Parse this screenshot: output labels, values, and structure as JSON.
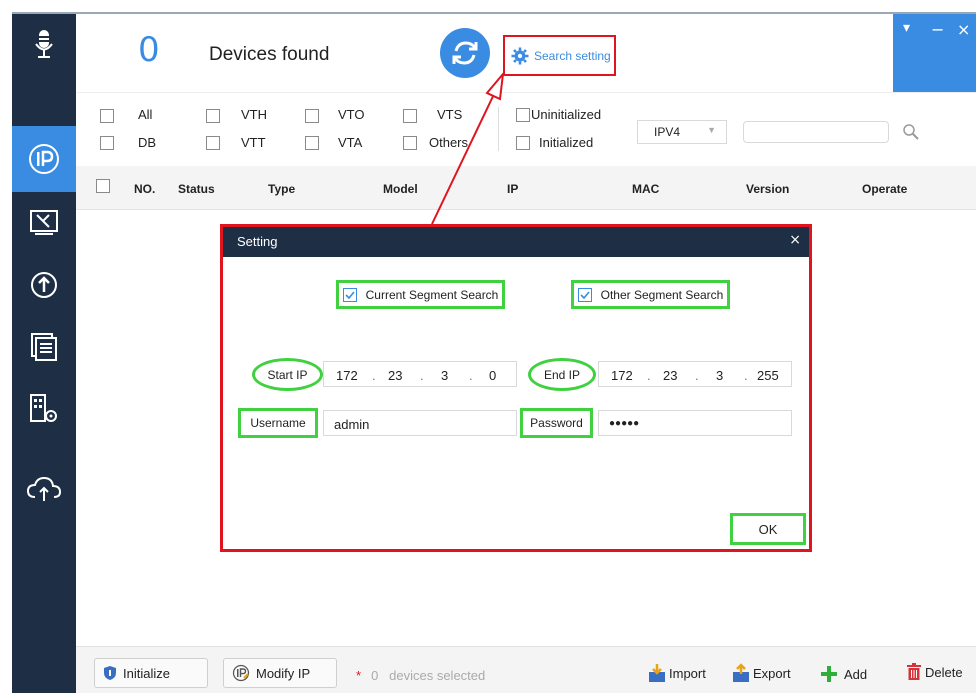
{
  "header": {
    "count": "0",
    "devices_found": "Devices found",
    "search_setting_label": "Search setting",
    "window_controls": {
      "menu": "▾",
      "minimize": "−",
      "close": "×"
    }
  },
  "filters": {
    "row1": [
      {
        "label": "All"
      },
      {
        "label": "VTH"
      },
      {
        "label": "VTO"
      },
      {
        "label": "VTS"
      }
    ],
    "row2": [
      {
        "label": "DB"
      },
      {
        "label": "VTT"
      },
      {
        "label": "VTA"
      },
      {
        "label": "Others"
      }
    ],
    "uninitialized": "Uninitialized",
    "initialized": "Initialized",
    "ip_version": "IPV4",
    "search_placeholder": ""
  },
  "table": {
    "columns": [
      "NO.",
      "Status",
      "Type",
      "Model",
      "IP",
      "MAC",
      "Version",
      "Operate"
    ]
  },
  "bottom": {
    "initialize": "Initialize",
    "modify_ip": "Modify IP",
    "star": "*",
    "selected_count": "0",
    "selected_text": "devices selected",
    "import": "Import",
    "export": "Export",
    "add": "Add",
    "delete": "Delete"
  },
  "dialog": {
    "title": "Setting",
    "close": "×",
    "current_segment": "Current Segment Search",
    "other_segment": "Other Segment Search",
    "start_ip_label": "Start IP",
    "start_ip": [
      "172",
      "23",
      "3",
      "0"
    ],
    "end_ip_label": "End IP",
    "end_ip": [
      "172",
      "23",
      "3",
      "255"
    ],
    "username_label": "Username",
    "username": "admin",
    "password_label": "Password",
    "password": "●●●●●",
    "ok": "OK"
  },
  "colors": {
    "accent": "#3a8ce2",
    "sidebar": "#1e2e45",
    "annotation_red": "#e0141e",
    "annotation_green": "#3fd13f"
  },
  "sidebar": {
    "items": [
      {
        "icon": "microphone-icon"
      },
      {
        "icon": "ip-icon",
        "active": true
      },
      {
        "icon": "tools-icon"
      },
      {
        "icon": "upgrade-icon"
      },
      {
        "icon": "document-icon"
      },
      {
        "icon": "building-settings-icon"
      },
      {
        "icon": "cloud-upload-icon"
      }
    ]
  }
}
